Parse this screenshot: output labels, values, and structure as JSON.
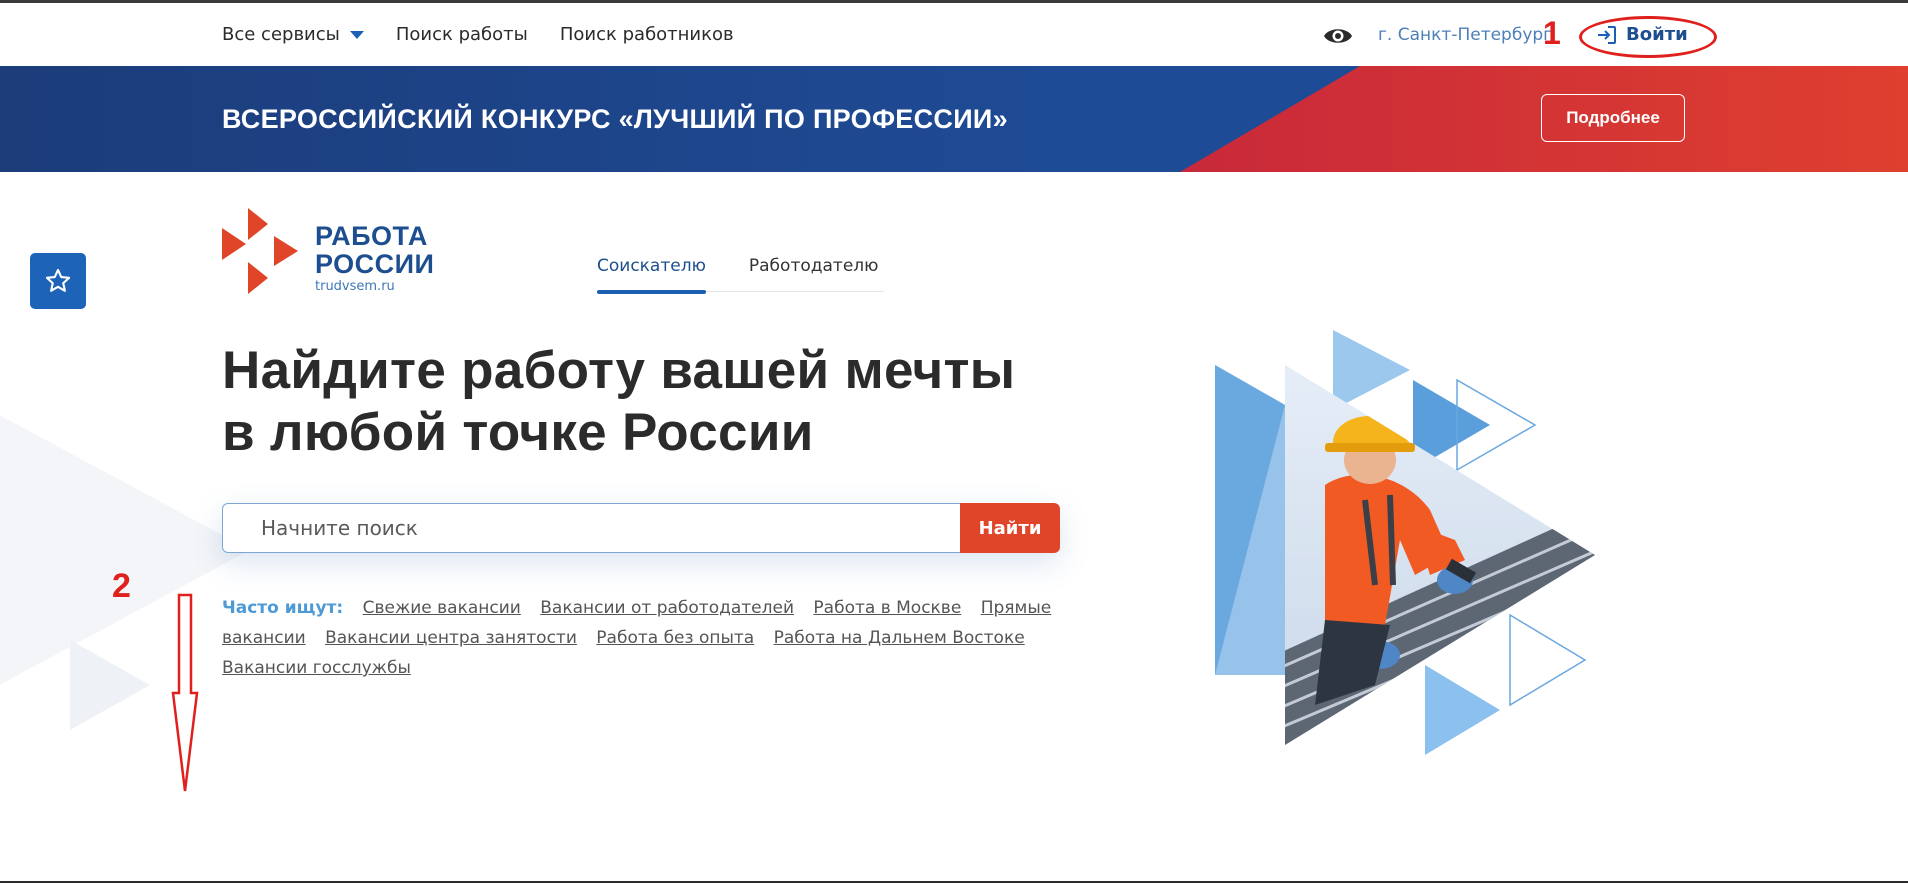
{
  "header": {
    "nav": [
      {
        "label": "Все сервисы",
        "has_dropdown": true
      },
      {
        "label": "Поиск работы"
      },
      {
        "label": "Поиск работников"
      }
    ],
    "city": "г. Санкт-Петербург",
    "login_label": "Войти",
    "annotation_1": "1"
  },
  "banner": {
    "title": "ВСЕРОССИЙСКИЙ КОНКУРС «ЛУЧШИЙ ПО ПРОФЕССИИ»",
    "button_label": "Подробнее"
  },
  "logo": {
    "line1": "РАБОТА",
    "line2": "РОССИИ",
    "url": "trudvsem.ru"
  },
  "tabs": [
    {
      "label": "Соискателю",
      "active": true
    },
    {
      "label": "Работодателю",
      "active": false
    }
  ],
  "hero": {
    "line1": "Найдите работу вашей мечты",
    "line2": "в любой точке России"
  },
  "search": {
    "placeholder": "Начните поиск",
    "value": "",
    "button_label": "Найти"
  },
  "popular": {
    "label": "Часто ищут:",
    "links": [
      "Свежие вакансии",
      "Вакансии от работодателей",
      "Работа в Москве",
      "Прямые вакансии",
      "Вакансии центра занятости",
      "Работа без опыта",
      "Работа на Дальнем Востоке",
      "Вакансии госслужбы"
    ]
  },
  "annotation_2": "2",
  "colors": {
    "brand_blue": "#1d4e8f",
    "accent_blue": "#1d5fb3",
    "accent_orange": "#e0452a",
    "annotation_red": "#e0201d"
  },
  "icons": {
    "dropdown": "chevron-down-icon",
    "eye": "eye-icon",
    "login": "login-icon",
    "favorite": "star-icon"
  }
}
